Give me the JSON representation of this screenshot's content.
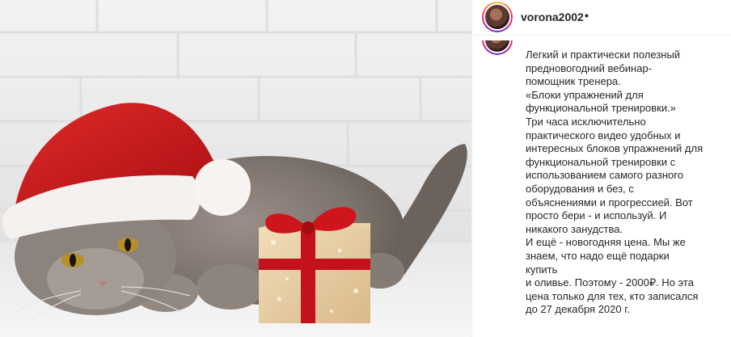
{
  "post": {
    "username": "vorona2002",
    "separator": "•",
    "caption": "Легкий и практически полезный\nпредновогодний вебинар-\nпомощник тренера.\n«Блоки упражнений для\nфункциональной тренировки.»\nТри часа исключительно\nпрактического видео удобных и\nинтересных блоков упражнений для\nфункциональной тренировки с\nиспользованием самого разного\nоборудования и без, с\nобъяснениями и прогрессией. Вот\nпросто бери - и используй. И\nникакого занудства.\nИ ещё - новогодняя цена. Мы же\nзнаем, что надо ещё подарки купить\nи оливье. Поэтому - 2000₽. Но эта\nцена только для тех, кто записался\nдо 27 декабря 2020 г."
  },
  "colors": {
    "accent_red": "#d0161c",
    "text": "#262626",
    "border": "#efefef"
  }
}
